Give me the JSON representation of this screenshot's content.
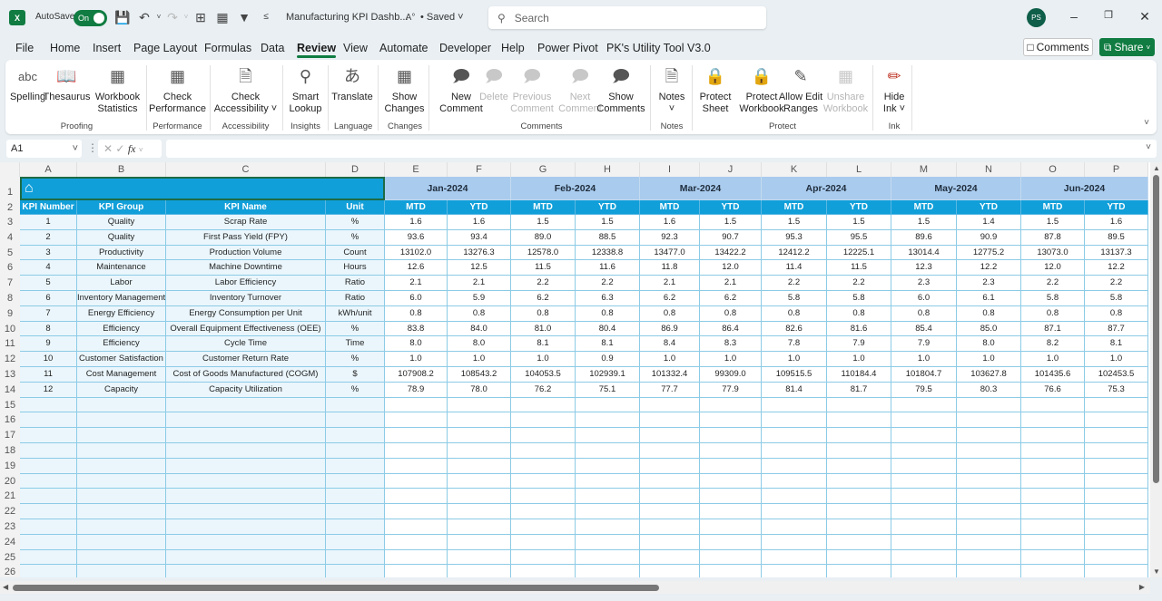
{
  "titlebar": {
    "app_icon": "X",
    "autosave_label": "AutoSave",
    "autosave_state": "On",
    "doc_title": "Manufacturing KPI Dashb...",
    "save_status": "• Saved",
    "search_placeholder": "Search",
    "user_initials": "PS",
    "icons": [
      "save-icon",
      "undo-icon",
      "redo-icon",
      "borders-icon",
      "picture-icon",
      "filter-icon",
      "customize-qat-icon"
    ]
  },
  "menu": {
    "tabs": [
      "File",
      "Home",
      "Insert",
      "Page Layout",
      "Formulas",
      "Data",
      "Review",
      "View",
      "Automate",
      "Developer",
      "Help",
      "Power Pivot",
      "PK's Utility Tool V3.0"
    ],
    "active": "Review",
    "comments_label": "Comments",
    "share_label": "Share"
  },
  "ribbon": {
    "groups": [
      {
        "label": "Proofing",
        "buttons": [
          {
            "label": "Spelling",
            "icon": "spelling-icon"
          },
          {
            "label": "Thesaurus",
            "icon": "thesaurus-icon"
          },
          {
            "label": "Workbook Statistics",
            "icon": "workbook-statistics-icon"
          }
        ]
      },
      {
        "label": "Performance",
        "buttons": [
          {
            "label": "Check Performance",
            "icon": "check-performance-icon"
          }
        ]
      },
      {
        "label": "Accessibility",
        "buttons": [
          {
            "label": "Check Accessibility ˅",
            "icon": "check-accessibility-icon"
          }
        ]
      },
      {
        "label": "Insights",
        "buttons": [
          {
            "label": "Smart Lookup",
            "icon": "smart-lookup-icon"
          }
        ]
      },
      {
        "label": "Language",
        "buttons": [
          {
            "label": "Translate",
            "icon": "translate-icon"
          }
        ]
      },
      {
        "label": "Changes",
        "buttons": [
          {
            "label": "Show Changes",
            "icon": "show-changes-icon"
          }
        ]
      },
      {
        "label": "Comments",
        "buttons": [
          {
            "label": "New Comment",
            "icon": "new-comment-icon"
          },
          {
            "label": "Delete",
            "icon": "delete-comment-icon",
            "disabled": true
          },
          {
            "label": "Previous Comment",
            "icon": "previous-comment-icon",
            "disabled": true
          },
          {
            "label": "Next Comment",
            "icon": "next-comment-icon",
            "disabled": true
          },
          {
            "label": "Show Comments",
            "icon": "show-comments-icon"
          }
        ]
      },
      {
        "label": "Notes",
        "buttons": [
          {
            "label": "Notes ˅",
            "icon": "notes-icon"
          }
        ]
      },
      {
        "label": "Protect",
        "buttons": [
          {
            "label": "Protect Sheet",
            "icon": "protect-sheet-icon"
          },
          {
            "label": "Protect Workbook",
            "icon": "protect-workbook-icon"
          },
          {
            "label": "Allow Edit Ranges",
            "icon": "allow-edit-ranges-icon"
          },
          {
            "label": "Unshare Workbook",
            "icon": "unshare-workbook-icon",
            "disabled": true
          }
        ]
      },
      {
        "label": "Ink",
        "buttons": [
          {
            "label": "Hide Ink ˅",
            "icon": "hide-ink-icon"
          }
        ]
      }
    ]
  },
  "formula_bar": {
    "name_box": "A1",
    "fx_label": "fx",
    "formula": ""
  },
  "sheet": {
    "columns": [
      "A",
      "B",
      "C",
      "D",
      "E",
      "F",
      "G",
      "H",
      "I",
      "J",
      "K",
      "L",
      "M",
      "N",
      "O",
      "P"
    ],
    "rows": [
      "1",
      "2",
      "3",
      "4",
      "5",
      "6",
      "7",
      "8",
      "9",
      "10",
      "11",
      "12",
      "13",
      "14",
      "15",
      "16",
      "17",
      "18",
      "19",
      "20",
      "21",
      "22",
      "23",
      "24",
      "25",
      "26"
    ],
    "header_icon": "home-icon",
    "headers": [
      "KPI Number",
      "KPI Group",
      "KPI Name",
      "Unit"
    ],
    "months": [
      "Jan-2024",
      "Feb-2024",
      "Mar-2024",
      "Apr-2024",
      "May-2024",
      "Jun-2024"
    ],
    "sub_headers": [
      "MTD",
      "YTD"
    ],
    "kpis": [
      {
        "num": "1",
        "group": "Quality",
        "name": "Scrap Rate",
        "unit": "%",
        "values": [
          "1.6",
          "1.6",
          "1.5",
          "1.5",
          "1.6",
          "1.5",
          "1.5",
          "1.5",
          "1.5",
          "1.4",
          "1.5",
          "1.6"
        ]
      },
      {
        "num": "2",
        "group": "Quality",
        "name": "First Pass Yield (FPY)",
        "unit": "%",
        "values": [
          "93.6",
          "93.4",
          "89.0",
          "88.5",
          "92.3",
          "90.7",
          "95.3",
          "95.5",
          "89.6",
          "90.9",
          "87.8",
          "89.5"
        ]
      },
      {
        "num": "3",
        "group": "Productivity",
        "name": "Production Volume",
        "unit": "Count",
        "values": [
          "13102.0",
          "13276.3",
          "12578.0",
          "12338.8",
          "13477.0",
          "13422.2",
          "12412.2",
          "12225.1",
          "13014.4",
          "12775.2",
          "13073.0",
          "13137.3"
        ]
      },
      {
        "num": "4",
        "group": "Maintenance",
        "name": "Machine Downtime",
        "unit": "Hours",
        "values": [
          "12.6",
          "12.5",
          "11.5",
          "11.6",
          "11.8",
          "12.0",
          "11.4",
          "11.5",
          "12.3",
          "12.2",
          "12.0",
          "12.2"
        ]
      },
      {
        "num": "5",
        "group": "Labor",
        "name": "Labor Efficiency",
        "unit": "Ratio",
        "values": [
          "2.1",
          "2.1",
          "2.2",
          "2.2",
          "2.1",
          "2.1",
          "2.2",
          "2.2",
          "2.3",
          "2.3",
          "2.2",
          "2.2"
        ]
      },
      {
        "num": "6",
        "group": "Inventory Management",
        "name": "Inventory Turnover",
        "unit": "Ratio",
        "values": [
          "6.0",
          "5.9",
          "6.2",
          "6.3",
          "6.2",
          "6.2",
          "5.8",
          "5.8",
          "6.0",
          "6.1",
          "5.8",
          "5.8"
        ]
      },
      {
        "num": "7",
        "group": "Energy Efficiency",
        "name": "Energy Consumption per Unit",
        "unit": "kWh/unit",
        "values": [
          "0.8",
          "0.8",
          "0.8",
          "0.8",
          "0.8",
          "0.8",
          "0.8",
          "0.8",
          "0.8",
          "0.8",
          "0.8",
          "0.8"
        ]
      },
      {
        "num": "8",
        "group": "Efficiency",
        "name": "Overall Equipment Effectiveness (OEE)",
        "unit": "%",
        "values": [
          "83.8",
          "84.0",
          "81.0",
          "80.4",
          "86.9",
          "86.4",
          "82.6",
          "81.6",
          "85.4",
          "85.0",
          "87.1",
          "87.7"
        ]
      },
      {
        "num": "9",
        "group": "Efficiency",
        "name": "Cycle Time",
        "unit": "Time",
        "values": [
          "8.0",
          "8.0",
          "8.1",
          "8.1",
          "8.4",
          "8.3",
          "7.8",
          "7.9",
          "7.9",
          "8.0",
          "8.2",
          "8.1"
        ]
      },
      {
        "num": "10",
        "group": "Customer Satisfaction",
        "name": "Customer Return Rate",
        "unit": "%",
        "values": [
          "1.0",
          "1.0",
          "1.0",
          "0.9",
          "1.0",
          "1.0",
          "1.0",
          "1.0",
          "1.0",
          "1.0",
          "1.0",
          "1.0"
        ]
      },
      {
        "num": "11",
        "group": "Cost Management",
        "name": "Cost of Goods Manufactured (COGM)",
        "unit": "$",
        "values": [
          "107908.2",
          "108543.2",
          "104053.5",
          "102939.1",
          "101332.4",
          "99309.0",
          "109515.5",
          "110184.4",
          "101804.7",
          "103627.8",
          "101435.6",
          "102453.5"
        ]
      },
      {
        "num": "12",
        "group": "Capacity",
        "name": "Capacity Utilization",
        "unit": "%",
        "values": [
          "78.9",
          "78.0",
          "76.2",
          "75.1",
          "77.7",
          "77.9",
          "81.4",
          "81.7",
          "79.5",
          "80.3",
          "76.6",
          "75.3"
        ]
      }
    ],
    "colors": {
      "header_blue": "#119fd9",
      "month_blue": "#a9cbed",
      "left_fill": "#eaf6fc",
      "grid": "#8ccbe6"
    }
  }
}
